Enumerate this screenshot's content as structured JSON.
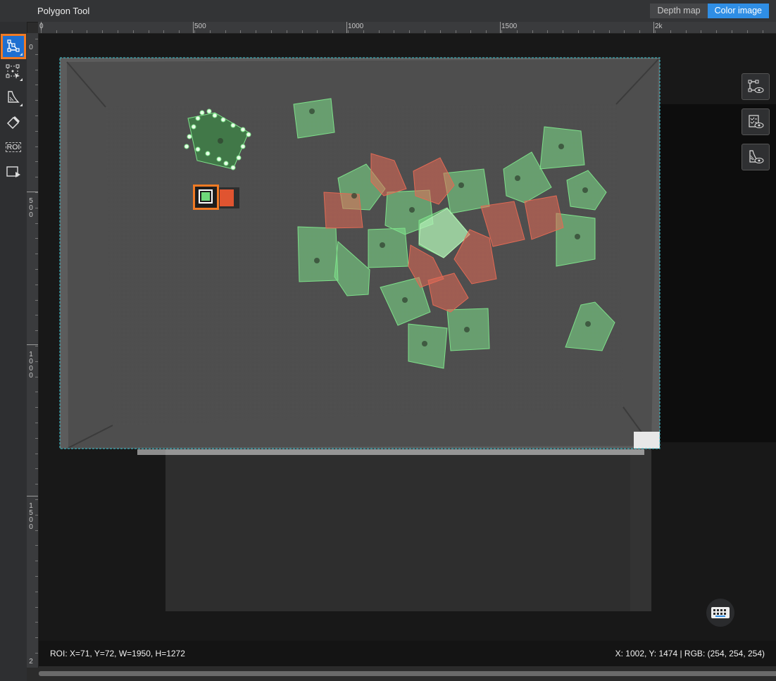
{
  "app": {
    "title": "Polygon Tool"
  },
  "view_tabs": [
    {
      "label": "Depth map",
      "active": false
    },
    {
      "label": "Color image",
      "active": true
    }
  ],
  "left_tools": [
    {
      "name": "polygon-tool-icon",
      "active": true
    },
    {
      "name": "point-select-tool-icon",
      "active": false
    },
    {
      "name": "slope-mask-tool-icon",
      "active": false
    },
    {
      "name": "eraser-tool-icon",
      "active": false
    },
    {
      "name": "roi-tool-icon",
      "label": "ROI",
      "active": false
    },
    {
      "name": "image-play-tool-icon",
      "active": false
    }
  ],
  "ruler": {
    "horizontal_labels": [
      "0",
      "500",
      "1000",
      "1500",
      "2k"
    ],
    "vertical_labels": [
      "0",
      "500",
      "1000",
      "1500",
      "2"
    ]
  },
  "right_tools": [
    {
      "name": "show-polygons-icon"
    },
    {
      "name": "show-labels-list-icon"
    },
    {
      "name": "show-masks-icon"
    }
  ],
  "status": {
    "roi": "ROI: X=71, Y=72, W=1950, H=1272",
    "cursor": "X: 1002, Y: 1474 | RGB: (254, 254, 254)"
  },
  "colors": {
    "accent": "#2f8ee5",
    "highlight": "#f07a24",
    "label_green": "#7ee08a",
    "label_red": "#e26a55",
    "roi_border": "#3ac7d6"
  }
}
